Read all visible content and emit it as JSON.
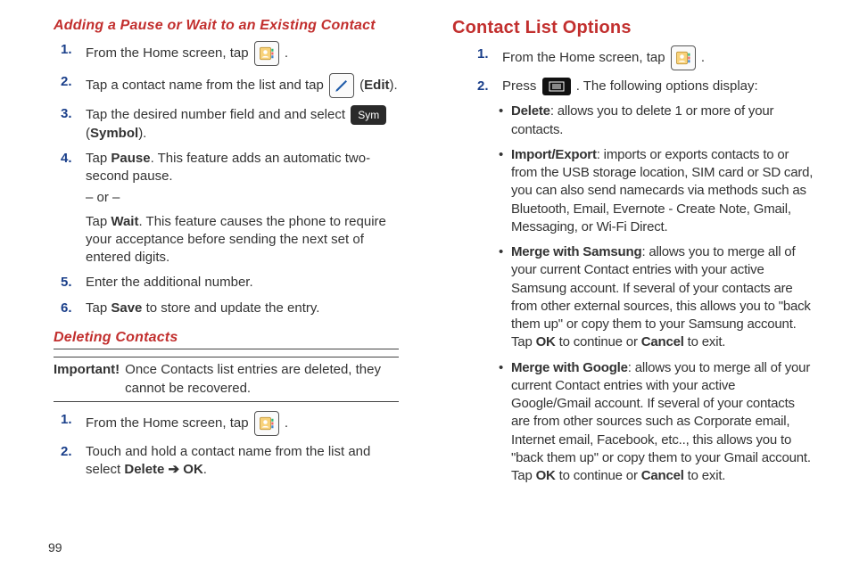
{
  "pageNumber": "99",
  "left": {
    "h1": "Adding a Pause or Wait to an Existing Contact",
    "s1_a": "From the Home screen, tap ",
    "s1_b": " .",
    "s2_a": "Tap a contact name from the list and tap ",
    "s2_b": " (",
    "s2_c": "Edit",
    "s2_d": ").",
    "s3_a": "Tap the desired number field and and select ",
    "s3_sym": "Sym",
    "s3_b": " (",
    "s3_c": "Symbol",
    "s3_d": ").",
    "s4_a": "Tap ",
    "s4_b": "Pause",
    "s4_c": ". This feature adds an automatic two-second pause.",
    "or": "– or –",
    "s4_d": "Tap ",
    "s4_e": "Wait",
    "s4_f": ". This feature causes the phone to require your acceptance before sending the next set of entered digits.",
    "s5": "Enter the additional number.",
    "s6_a": "Tap ",
    "s6_b": "Save",
    "s6_c": " to store and update the entry.",
    "h2": "Deleting Contacts",
    "imp_lbl": "Important!",
    "imp_txt": "Once Contacts list entries are deleted, they cannot be recovered.",
    "d1_a": "From the Home screen, tap ",
    "d1_b": " .",
    "d2_a": "Touch and hold a contact name from the list and select ",
    "d2_b": "Delete",
    "d2_arrow": " ➔ ",
    "d2_c": "OK",
    "d2_d": "."
  },
  "right": {
    "h1": "Contact List Options",
    "s1_a": "From the Home screen, tap ",
    "s1_b": " .",
    "s2_a": "Press ",
    "s2_b": ". The following options display:",
    "b1_a": "Delete",
    "b1_b": ": allows you to delete 1 or more of your contacts.",
    "b2_a": "Import/Export",
    "b2_b": ": imports or exports contacts to or from the USB storage location, SIM card or SD card, you can also send namecards via methods such as Bluetooth, Email, Evernote - Create Note, Gmail, Messaging, or Wi-Fi Direct.",
    "b3_a": "Merge with Samsung",
    "b3_b": ": allows you to merge all of your current Contact entries with your active Samsung account. If several of your contacts are from other external sources, this allows you to \"back them up\" or copy them to your Samsung account. Tap ",
    "b3_c": "OK",
    "b3_d": " to continue or ",
    "b3_e": "Cancel",
    "b3_f": " to exit.",
    "b4_a": "Merge with Google",
    "b4_b": ": allows you to merge all of your current Contact entries with your active Google/Gmail account. If several of your contacts are from other sources such as Corporate email, Internet email, Facebook, etc.., this allows you to \"back them up\" or copy them to your Gmail account. Tap ",
    "b4_c": "OK",
    "b4_d": " to continue or ",
    "b4_e": "Cancel",
    "b4_f": " to exit."
  }
}
